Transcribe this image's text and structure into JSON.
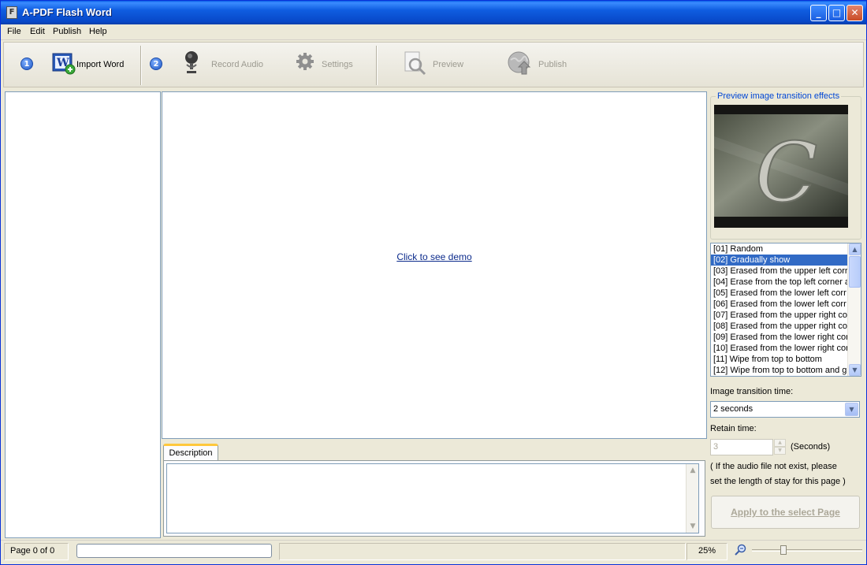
{
  "window": {
    "title": "A-PDF Flash Word",
    "app_icon_letter": "F",
    "minimize": "_",
    "maximize": "□",
    "close": "✕"
  },
  "menu": [
    "File",
    "Edit",
    "Publish",
    "Help"
  ],
  "toolbar": {
    "step1": "1",
    "step2": "2",
    "import_word": "Import Word",
    "record_audio": "Record Audio",
    "settings": "Settings",
    "preview": "Preview",
    "publish": "Publish"
  },
  "canvas": {
    "demo_link": "Click to see demo"
  },
  "description": {
    "tab_label": "Description",
    "text": ""
  },
  "transition": {
    "preview_legend": "Preview image transition effects",
    "preview_letter": "C",
    "effects": [
      "[01] Random",
      "[02] Gradually show",
      "[03] Erased from the upper left corr",
      "[04] Erase from the top left corner a",
      "[05] Erased from the lower left corr",
      "[06] Erased from the lower left corr",
      "[07] Erased from the upper right cor",
      "[08] Erased from the upper right cor",
      "[09] Erased from the lower right cor",
      "[10] Erased from the lower right cor",
      "[11] Wipe from top to bottom",
      "[12] Wipe from top to bottom and gr"
    ],
    "selected_index": 1,
    "time_label": "Image transition time:",
    "time_value": "2 seconds",
    "retain_label": "Retain time:",
    "retain_value": "3",
    "retain_unit": "(Seconds)",
    "note_line1": "( If the audio file not exist, please",
    "note_line2": "set the length of stay for this page )",
    "apply_button": "Apply to the select Page"
  },
  "status": {
    "page": "Page 0 of 0",
    "zoom": "25%"
  },
  "colors": {
    "titlebar": "#0a5fe6",
    "selection": "#316ac5",
    "link": "#0c2b8c",
    "legend": "#0046d5"
  }
}
